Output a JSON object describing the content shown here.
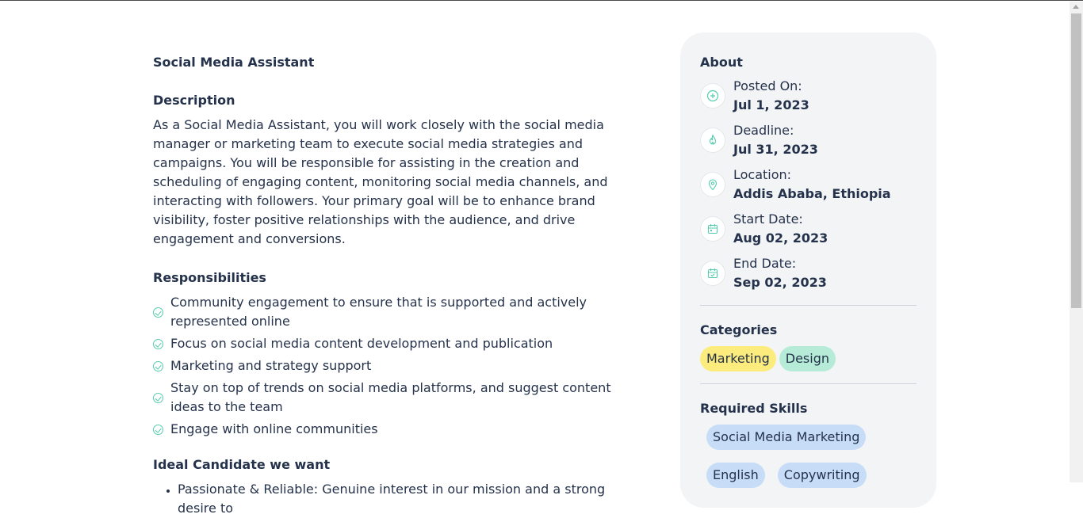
{
  "job": {
    "title": "Social Media Assistant",
    "description_heading": "Description",
    "description": "As a Social Media Assistant, you will work closely with the social media manager or marketing team to execute social media strategies and campaigns. You will be responsible for assisting in the creation and scheduling of engaging content, monitoring social media channels, and interacting with followers. Your primary goal will be to enhance brand visibility, foster positive relationships with the audience, and drive engagement and conversions.",
    "responsibilities_heading": "Responsibilities",
    "responsibilities": [
      "Community engagement to ensure that is supported and actively represented online",
      "Focus on social media content development and publication",
      "Marketing and strategy support",
      "Stay on top of trends on social media platforms, and suggest content ideas to the team",
      "Engage with online communities"
    ],
    "ideal_heading": "Ideal Candidate we want",
    "ideal": [
      "Passionate & Reliable: Genuine interest in our mission and a strong desire to"
    ]
  },
  "about": {
    "heading": "About",
    "posted_label": "Posted On:",
    "posted_value": "Jul 1, 2023",
    "deadline_label": "Deadline:",
    "deadline_value": "Jul 31, 2023",
    "location_label": "Location:",
    "location_value": "Addis Ababa, Ethiopia",
    "start_label": "Start Date:",
    "start_value": "Aug 02, 2023",
    "end_label": "End Date:",
    "end_value": "Sep 02, 2023"
  },
  "categories": {
    "heading": "Categories",
    "items": [
      "Marketing",
      "Design"
    ]
  },
  "skills": {
    "heading": "Required Skills",
    "items": [
      "Social Media Marketing",
      "English",
      "Copywriting"
    ]
  },
  "colors": {
    "accent_green": "#56cdad",
    "marketing_tag": "#fcec7e",
    "design_tag": "#b6ecd7",
    "skill_tag": "#c6dcf7"
  }
}
